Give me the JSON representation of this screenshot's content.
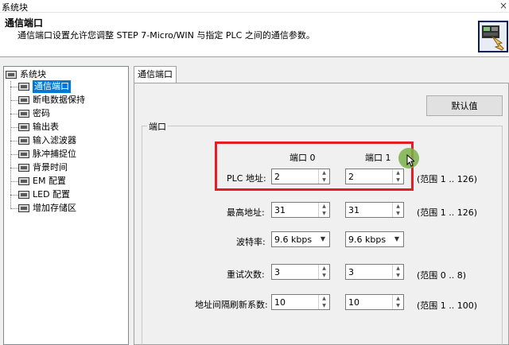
{
  "window": {
    "title": "系统块",
    "close_glyph": "×"
  },
  "header": {
    "title": "通信端口",
    "description": "通信端口设置允许您调整 STEP 7-Micro/WIN 与指定 PLC 之间的通信参数。",
    "icon": "system-block-hand-icon"
  },
  "tree": {
    "root": "系统块",
    "items": [
      "通信端口",
      "断电数据保持",
      "密码",
      "输出表",
      "输入滤波器",
      "脉冲捕捉位",
      "背景时间",
      "EM 配置",
      "LED 配置",
      "增加存储区"
    ],
    "selected_index": 0
  },
  "tab": {
    "label": "通信端口"
  },
  "buttons": {
    "default_values": "默认值"
  },
  "group": {
    "legend": "端口",
    "col_headers": [
      "端口 0",
      "端口 1"
    ],
    "rows": [
      {
        "label": "PLC 地址:",
        "type": "spin",
        "port0": "2",
        "port1": "2",
        "range": "(范围 1 .. 126)"
      },
      {
        "label": "最高地址:",
        "type": "spin",
        "port0": "31",
        "port1": "31",
        "range": "(范围 1 .. 126)"
      },
      {
        "label": "波特率:",
        "type": "combo",
        "port0": "9.6 kbps",
        "port1": "9.6 kbps",
        "range": ""
      },
      {
        "label": "重试次数:",
        "type": "spin",
        "port0": "3",
        "port1": "3",
        "range": "(范围 0 .. 8)"
      },
      {
        "label": "地址间隔刷新系数:",
        "type": "spin",
        "port0": "10",
        "port1": "10",
        "range": "(范围 1 .. 100)"
      }
    ]
  },
  "colors": {
    "highlight": "#e81c25",
    "selection": "#0078d7",
    "cursor_dot": "#7ab24a"
  }
}
